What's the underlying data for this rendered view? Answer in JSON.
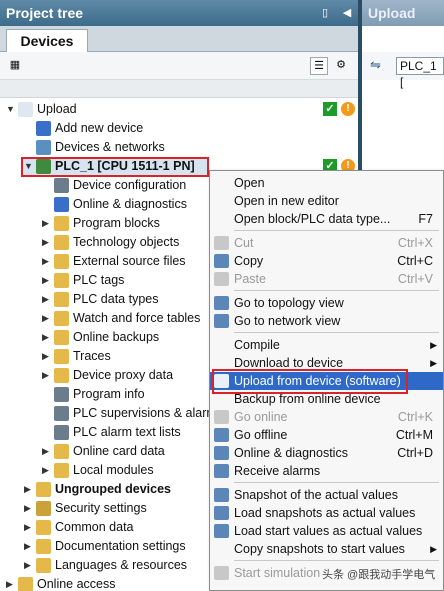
{
  "left_panel": {
    "title": "Project tree",
    "tab": "Devices"
  },
  "right_panel": {
    "title": "Upload",
    "input_value": "PLC_1 ["
  },
  "tree": [
    {
      "label": "Upload",
      "level": 0,
      "expanded": true,
      "icon": "project-icon",
      "color": "#dfe7f0",
      "bold": false
    },
    {
      "label": "Add new device",
      "level": 1,
      "icon": "add-device-icon",
      "color": "#3a6fc9"
    },
    {
      "label": "Devices & networks",
      "level": 1,
      "icon": "network-icon",
      "color": "#5a8fbf"
    },
    {
      "label": "PLC_1 [CPU 1511-1 PN]",
      "level": 1,
      "expanded": true,
      "icon": "plc-icon",
      "color": "#3f8a3f",
      "bold": true,
      "selected": true
    },
    {
      "label": "Device configuration",
      "level": 2,
      "icon": "device-config-icon",
      "color": "#6b7d8c"
    },
    {
      "label": "Online & diagnostics",
      "level": 2,
      "icon": "diagnostics-icon",
      "color": "#3a6fc9"
    },
    {
      "label": "Program blocks",
      "level": 2,
      "collapsed": true,
      "icon": "folder-icon",
      "color": "#e5b84a"
    },
    {
      "label": "Technology objects",
      "level": 2,
      "collapsed": true,
      "icon": "folder-icon",
      "color": "#e5b84a"
    },
    {
      "label": "External source files",
      "level": 2,
      "collapsed": true,
      "icon": "folder-icon",
      "color": "#e5b84a"
    },
    {
      "label": "PLC tags",
      "level": 2,
      "collapsed": true,
      "icon": "folder-icon",
      "color": "#e5b84a"
    },
    {
      "label": "PLC data types",
      "level": 2,
      "collapsed": true,
      "icon": "folder-icon",
      "color": "#e5b84a"
    },
    {
      "label": "Watch and force tables",
      "level": 2,
      "collapsed": true,
      "icon": "folder-icon",
      "color": "#e5b84a"
    },
    {
      "label": "Online backups",
      "level": 2,
      "collapsed": true,
      "icon": "folder-icon",
      "color": "#e5b84a"
    },
    {
      "label": "Traces",
      "level": 2,
      "collapsed": true,
      "icon": "folder-icon",
      "color": "#e5b84a"
    },
    {
      "label": "Device proxy data",
      "level": 2,
      "collapsed": true,
      "icon": "folder-icon",
      "color": "#e5b84a"
    },
    {
      "label": "Program info",
      "level": 2,
      "icon": "program-info-icon",
      "color": "#6b7d8c"
    },
    {
      "label": "PLC supervisions & alarms",
      "level": 2,
      "icon": "alarm-icon",
      "color": "#6b7d8c"
    },
    {
      "label": "PLC alarm text lists",
      "level": 2,
      "icon": "text-list-icon",
      "color": "#6b7d8c"
    },
    {
      "label": "Online card data",
      "level": 2,
      "collapsed": true,
      "icon": "folder-icon",
      "color": "#e5b84a"
    },
    {
      "label": "Local modules",
      "level": 2,
      "collapsed": true,
      "icon": "folder-icon",
      "color": "#e5b84a"
    },
    {
      "label": "Ungrouped devices",
      "level": 1,
      "collapsed": true,
      "icon": "folder-icon",
      "color": "#e5b84a",
      "bold": true
    },
    {
      "label": "Security settings",
      "level": 1,
      "collapsed": true,
      "icon": "security-icon",
      "color": "#c9a23a"
    },
    {
      "label": "Common data",
      "level": 1,
      "collapsed": true,
      "icon": "folder-icon",
      "color": "#e5b84a"
    },
    {
      "label": "Documentation settings",
      "level": 1,
      "collapsed": true,
      "icon": "folder-icon",
      "color": "#e5b84a"
    },
    {
      "label": "Languages & resources",
      "level": 1,
      "collapsed": true,
      "icon": "folder-icon",
      "color": "#e5b84a"
    },
    {
      "label": "Online access",
      "level": 0,
      "collapsed": true,
      "icon": "folder-icon",
      "color": "#e5b84a"
    }
  ],
  "context_menu": [
    {
      "label": "Open",
      "key": ""
    },
    {
      "label": "Open in new editor",
      "key": ""
    },
    {
      "label": "Open block/PLC data type...",
      "key": "F7"
    },
    {
      "sep": true
    },
    {
      "label": "Cut",
      "key": "Ctrl+X",
      "disabled": true,
      "icon": "cut-icon"
    },
    {
      "label": "Copy",
      "key": "Ctrl+C",
      "icon": "copy-icon"
    },
    {
      "label": "Paste",
      "key": "Ctrl+V",
      "disabled": true,
      "icon": "paste-icon"
    },
    {
      "sep": true
    },
    {
      "label": "Go to topology view",
      "key": "",
      "icon": "topology-icon"
    },
    {
      "label": "Go to network view",
      "key": "",
      "icon": "network-view-icon"
    },
    {
      "sep": true
    },
    {
      "label": "Compile",
      "key": "",
      "submenu": true
    },
    {
      "label": "Download to device",
      "key": "",
      "submenu": true
    },
    {
      "label": "Upload from device (software)",
      "key": "",
      "icon": "upload-icon",
      "highlighted": true
    },
    {
      "label": "Backup from online device",
      "key": ""
    },
    {
      "label": "Go online",
      "key": "Ctrl+K",
      "disabled": true,
      "icon": "go-online-icon"
    },
    {
      "label": "Go offline",
      "key": "Ctrl+M",
      "icon": "go-offline-icon"
    },
    {
      "label": "Online & diagnostics",
      "key": "Ctrl+D",
      "icon": "diagnostics-icon"
    },
    {
      "label": "Receive alarms",
      "key": "",
      "icon": "alarm-icon"
    },
    {
      "sep": true
    },
    {
      "label": "Snapshot of the actual values",
      "key": "",
      "icon": "snapshot-icon"
    },
    {
      "label": "Load snapshots as actual values",
      "key": "",
      "icon": "load-snapshot-icon"
    },
    {
      "label": "Load start values as actual values",
      "key": "",
      "icon": "load-start-icon"
    },
    {
      "label": "Copy snapshots to start values",
      "key": "",
      "submenu": true
    },
    {
      "sep": true
    },
    {
      "label": "Start simulation",
      "key": "",
      "disabled": true,
      "icon": "simulation-icon"
    }
  ],
  "watermark": "头条 @跟我动手学电气"
}
